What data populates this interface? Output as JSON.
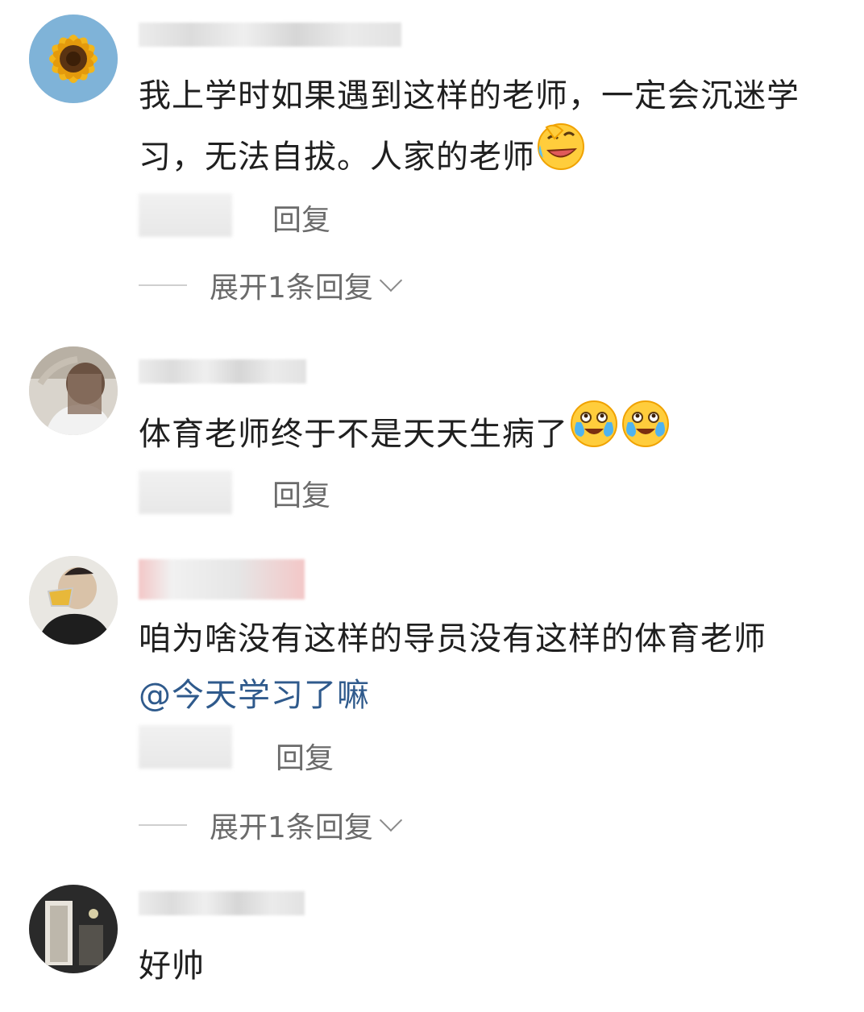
{
  "comments": [
    {
      "text": "我上学时如果遇到这样的老师，一定会沉迷学习，无法自拔。人家的老师",
      "emoji_icon": "rofl-face-icon",
      "reply_label": "回复",
      "expand_label": "展开1条回复"
    },
    {
      "text": "体育老师终于不是天天生病了",
      "emoji_icon": "laugh-crying-face-icon",
      "reply_label": "回复"
    },
    {
      "text": "咱为啥没有这样的导员没有这样的体育老师",
      "mention": "@今天学习了嘛",
      "reply_label": "回复",
      "expand_label": "展开1条回复"
    },
    {
      "text": "好帅"
    }
  ],
  "colors": {
    "mention": "#2f5a8c",
    "secondary_text": "#6b6b6b",
    "divider": "#cfcfcf"
  }
}
